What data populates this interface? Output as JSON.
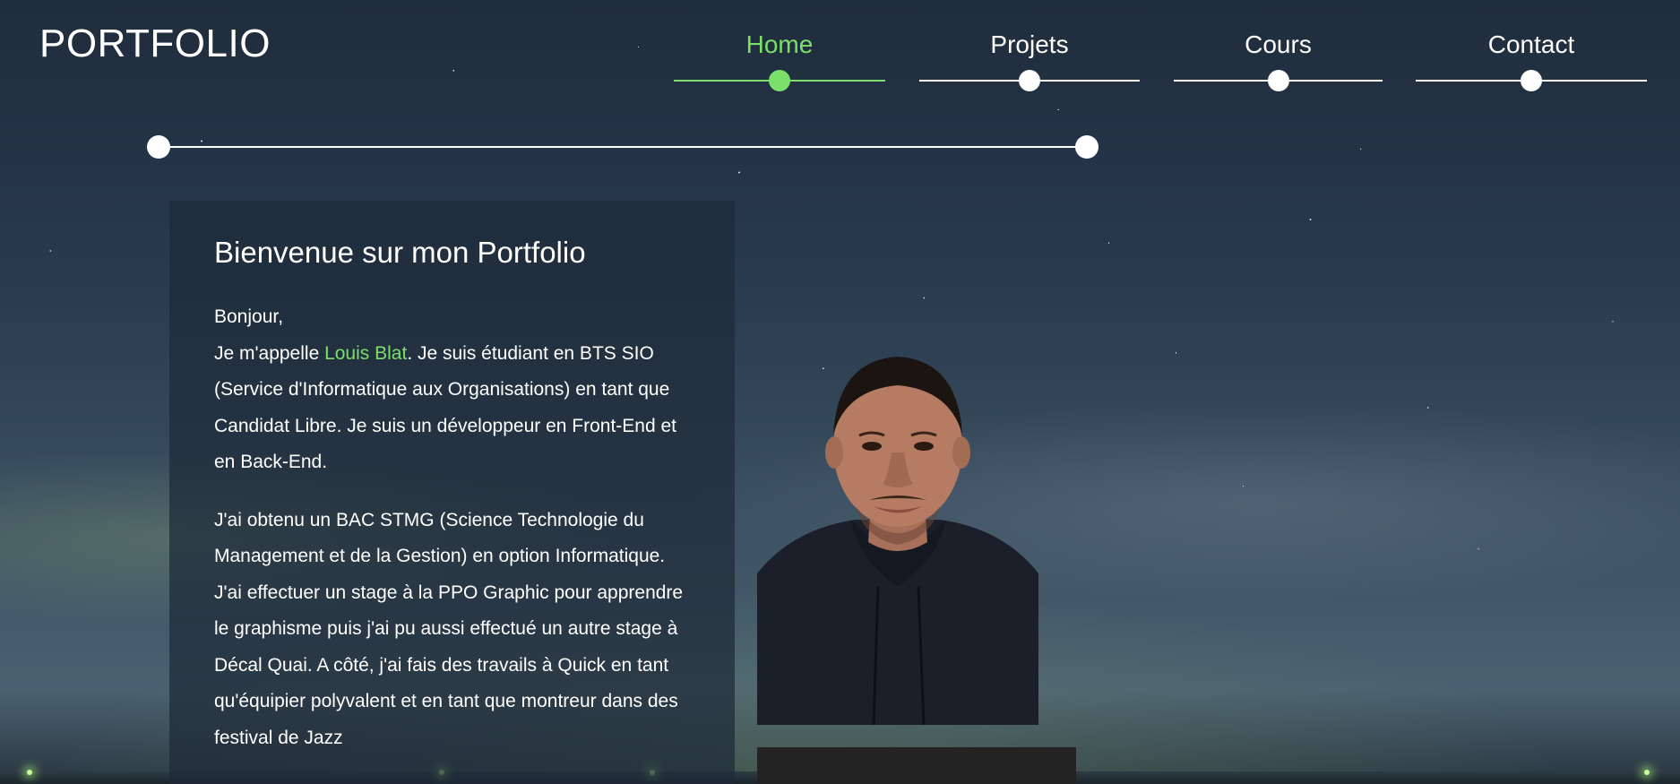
{
  "header": {
    "logo": "PORTFOLIO"
  },
  "nav": {
    "items": [
      {
        "label": "Home",
        "active": true
      },
      {
        "label": "Projets",
        "active": false
      },
      {
        "label": "Cours",
        "active": false
      },
      {
        "label": "Contact",
        "active": false
      }
    ]
  },
  "colors": {
    "accent": "#7ae06a",
    "text": "#ffffff",
    "card_bg": "rgba(30,42,56,0.72)",
    "panel_dark": "#232323"
  },
  "intro": {
    "title": "Bienvenue sur mon Portfolio",
    "greeting": "Bonjour,",
    "p1_prefix": "Je m'appelle ",
    "name": "Louis Blat",
    "p1_suffix": ". Je suis étudiant en BTS SIO (Service d'Informatique aux Organisations) en tant que Candidat Libre. Je suis un développeur en Front-End et en Back-End.",
    "p2": "J'ai obtenu un BAC STMG (Science Technologie du Management et de la Gestion) en option Informatique. J'ai effectuer un stage à la PPO Graphic pour apprendre le graphisme puis j'ai pu aussi effectué un autre stage à Décal Quai. A côté, j'ai fais des travails à Quick en tant qu'équipier polyvalent et en tant que montreur dans des festival de Jazz"
  },
  "photo": {
    "subject": "portrait photo of Louis Blat"
  }
}
